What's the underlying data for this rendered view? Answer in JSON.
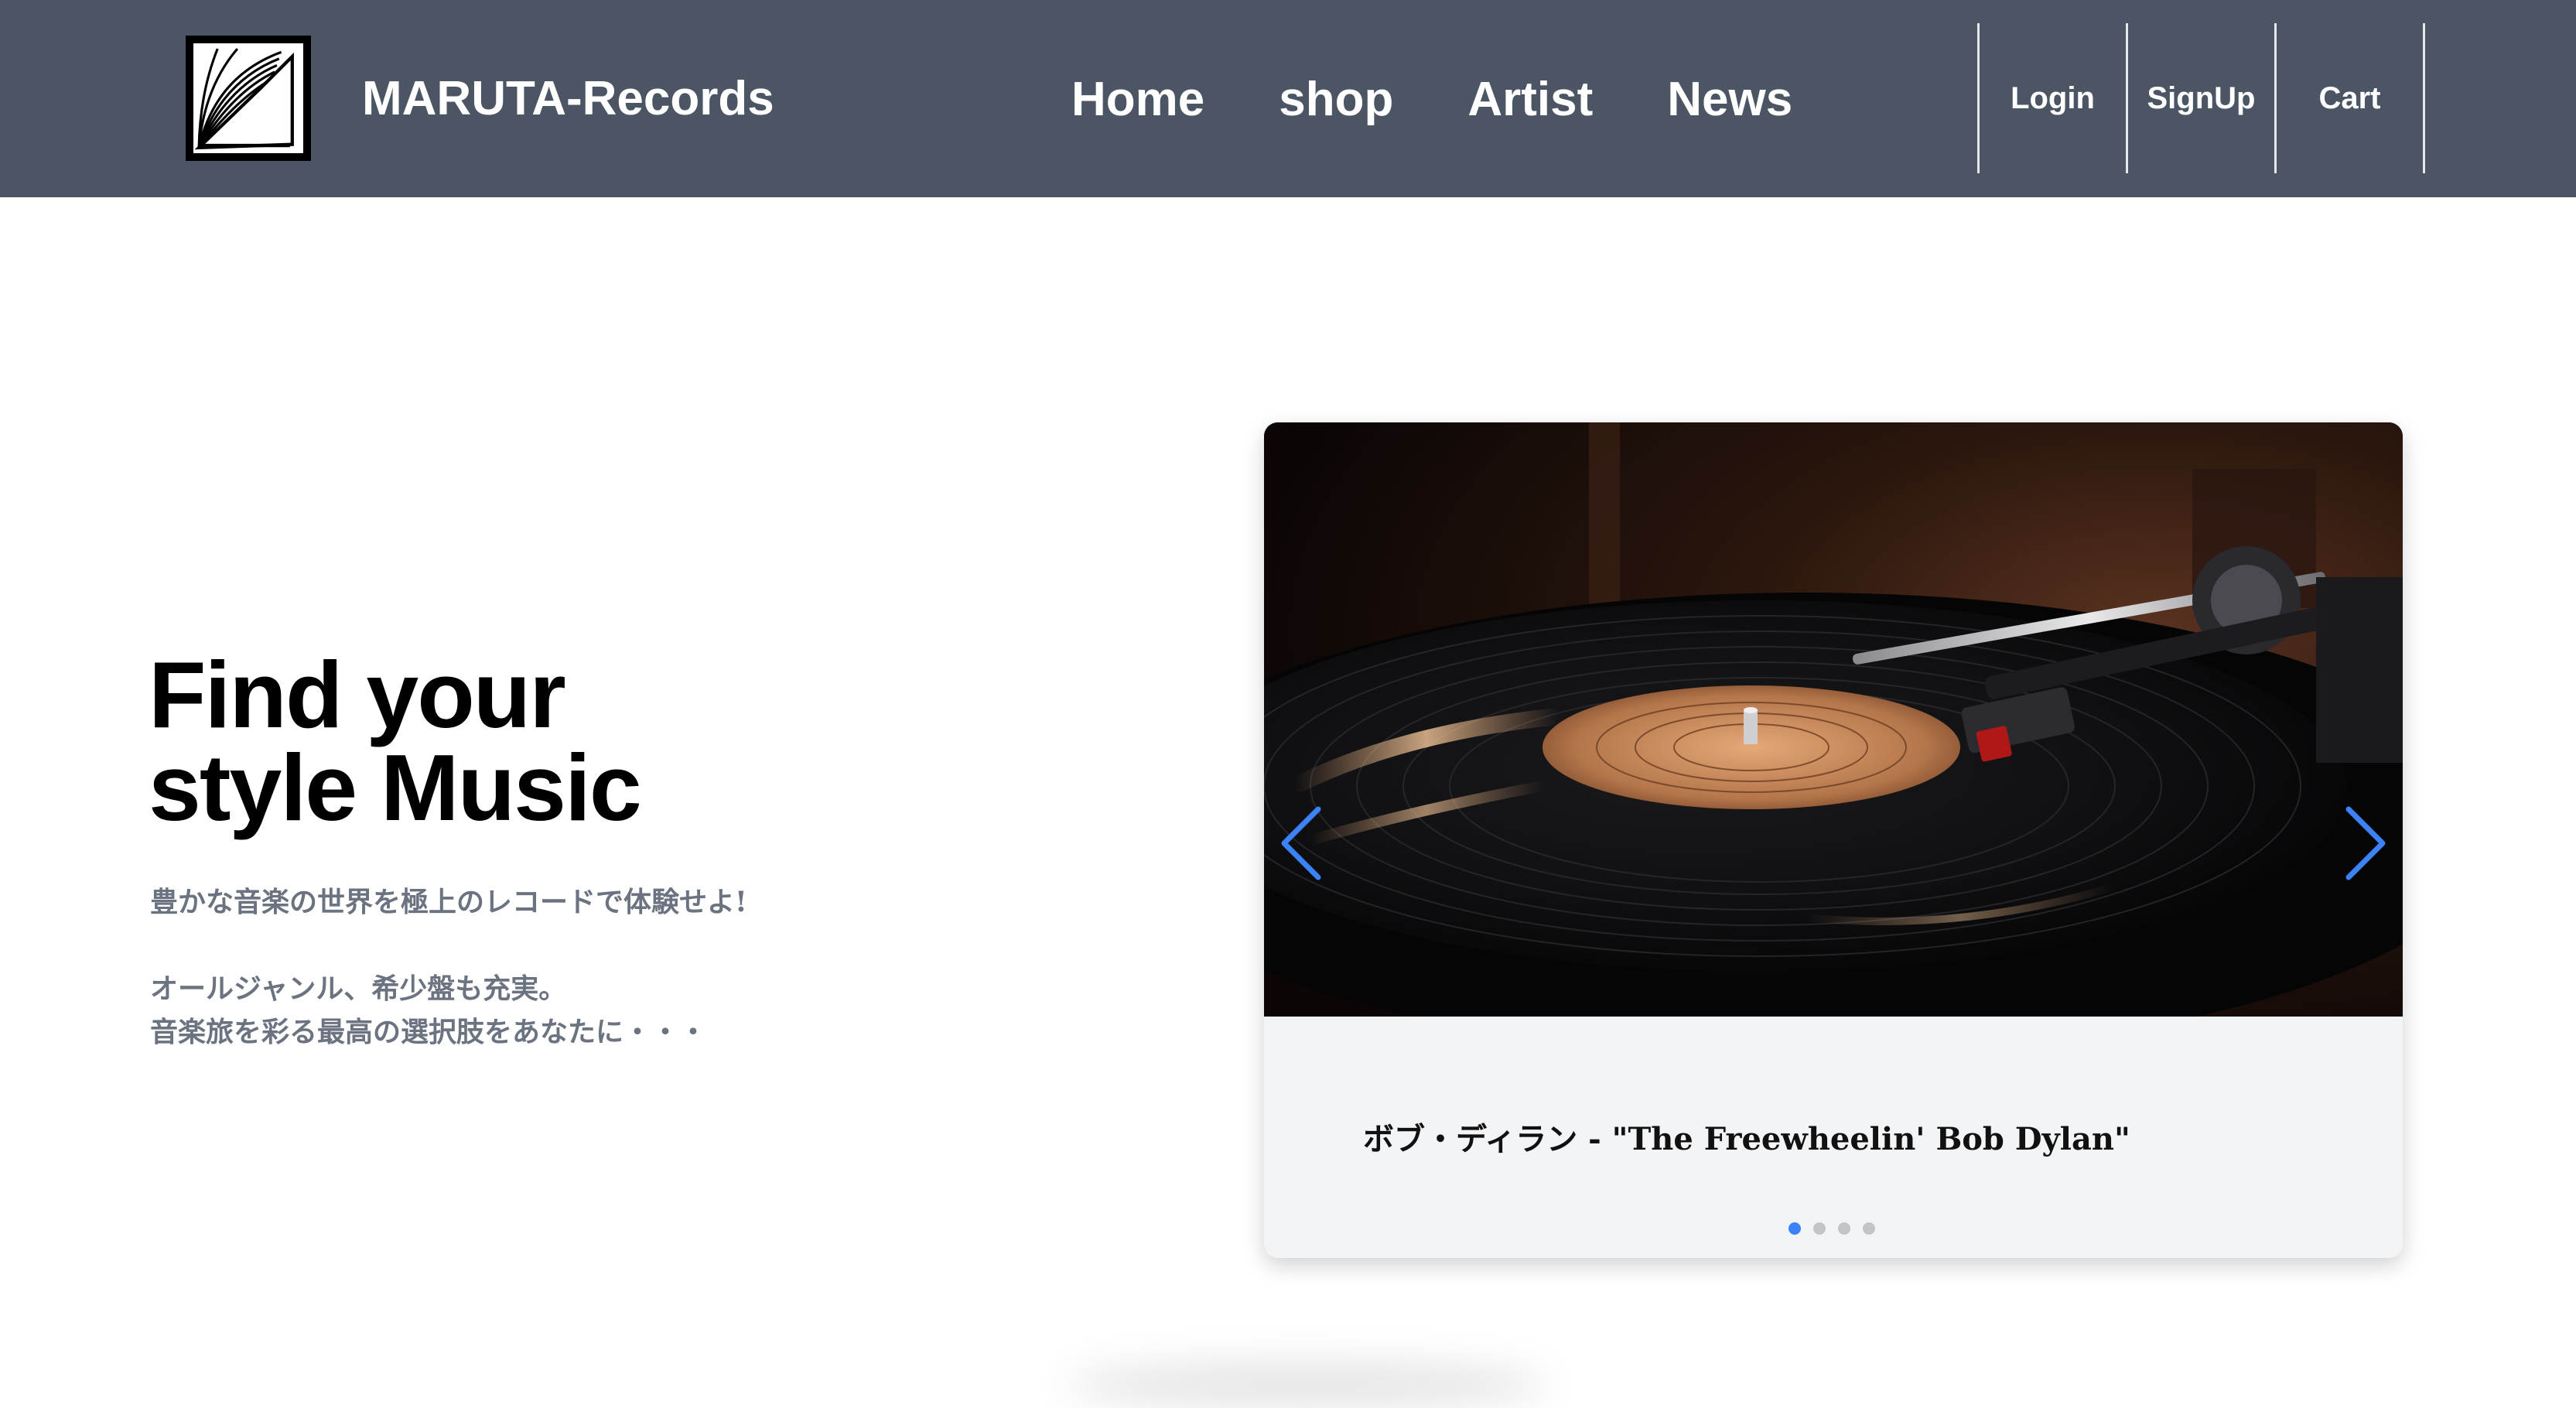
{
  "header": {
    "brand": "MARUTA-Records",
    "logo_icon": "record-sleeve-logo",
    "nav": [
      {
        "label": "Home"
      },
      {
        "label": "shop"
      },
      {
        "label": "Artist"
      },
      {
        "label": "News"
      }
    ],
    "account": [
      {
        "label": "Login"
      },
      {
        "label": "SignUp"
      },
      {
        "label": "Cart"
      }
    ],
    "background_color": "#4b5563"
  },
  "hero": {
    "title_line1": "Find your",
    "title_line2": "style Music",
    "desc_line1": "豊かな音楽の世界を極上のレコードで体験せよ!",
    "desc_line2": "オールジャンル、希少盤も充実。",
    "desc_line3": "音楽旅を彩る最高の選択肢をあなたに・・・"
  },
  "carousel": {
    "caption": "ボブ・ディラン - \"The Freewheelin' Bob Dylan\"",
    "image": "vinyl-turntable-photo",
    "prev_icon": "chevron-left-icon",
    "next_icon": "chevron-right-icon",
    "active_index": 0,
    "slide_count": 4,
    "accent_color": "#3b82f6"
  }
}
